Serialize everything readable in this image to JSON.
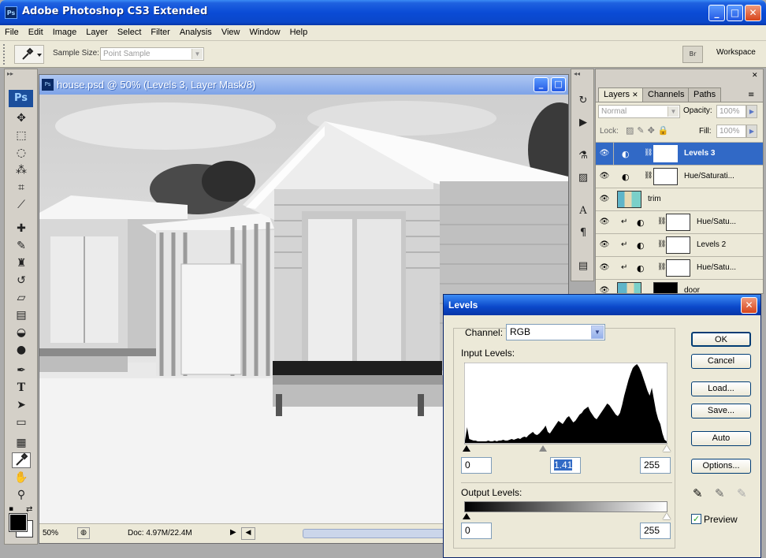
{
  "window": {
    "title": "Adobe Photoshop CS3 Extended",
    "logo": "Ps",
    "minimize": "_",
    "maximize": "□",
    "close": "✕"
  },
  "menu": [
    "File",
    "Edit",
    "Image",
    "Layer",
    "Select",
    "Filter",
    "Analysis",
    "View",
    "Window",
    "Help"
  ],
  "options": {
    "sample_size_label": "Sample Size:",
    "sample_size_value": "Point Sample",
    "workspace_label": "Workspace",
    "workspace_badge": "Br"
  },
  "toolbox": {
    "logo": "Ps",
    "tools": [
      "move-icon",
      "marquee-icon",
      "lasso-icon",
      "magic-wand-icon",
      "crop-icon",
      "slice-icon",
      "healing-icon",
      "brush-icon",
      "stamp-icon",
      "history-brush-icon",
      "eraser-icon",
      "gradient-icon",
      "blur-icon",
      "dodge-icon",
      "pen-icon",
      "type-icon",
      "path-select-icon",
      "shape-icon",
      "notes-icon",
      "eyedropper-icon",
      "hand-icon",
      "zoom-icon"
    ],
    "selected_tool": "eyedropper-icon",
    "type_glyph": "T"
  },
  "document": {
    "title": "house.psd @ 50% (Levels 3, Layer Mask/8)",
    "icon_text": "Ps",
    "zoom": "50%",
    "doc_info": "Doc: 4.97M/22.4M"
  },
  "layers_panel": {
    "tabs": [
      "Layers",
      "Channels",
      "Paths"
    ],
    "blend_mode": "Normal",
    "opacity_label": "Opacity:",
    "opacity_value": "100%",
    "lock_label": "Lock:",
    "fill_label": "Fill:",
    "fill_value": "100%",
    "layers": [
      {
        "name": "Levels 3",
        "type": "adjustment",
        "selected": true,
        "clipped": false
      },
      {
        "name": "Hue/Saturati...",
        "type": "adjustment",
        "selected": false,
        "clipped": false
      },
      {
        "name": "trim",
        "type": "pixel",
        "selected": false,
        "clipped": false
      },
      {
        "name": "Hue/Satu...",
        "type": "adjustment",
        "selected": false,
        "clipped": true
      },
      {
        "name": "Levels 2",
        "type": "adjustment",
        "selected": false,
        "clipped": true
      },
      {
        "name": "Hue/Satu...",
        "type": "adjustment",
        "selected": false,
        "clipped": true
      },
      {
        "name": "door",
        "type": "pixel",
        "selected": false,
        "clipped": false
      }
    ]
  },
  "levels_dialog": {
    "title": "Levels",
    "channel_label": "Channel:",
    "channel_value": "RGB",
    "input_levels_label": "Input Levels:",
    "input_black": "0",
    "input_gamma": "1.41",
    "input_white": "255",
    "output_levels_label": "Output Levels:",
    "output_black": "0",
    "output_white": "255",
    "buttons": {
      "ok": "OK",
      "cancel": "Cancel",
      "load": "Load...",
      "save": "Save...",
      "auto": "Auto",
      "options": "Options..."
    },
    "preview_label": "Preview",
    "preview_checked": true,
    "gamma_slider_position": 0.38,
    "histogram": [
      3,
      20,
      5,
      4,
      3,
      3,
      2,
      2,
      2,
      2,
      2,
      3,
      2,
      2,
      3,
      2,
      3,
      3,
      4,
      3,
      3,
      4,
      5,
      4,
      5,
      6,
      5,
      7,
      8,
      7,
      10,
      12,
      14,
      11,
      10,
      12,
      15,
      18,
      22,
      14,
      12,
      16,
      20,
      24,
      28,
      26,
      24,
      28,
      32,
      34,
      30,
      26,
      28,
      32,
      36,
      38,
      42,
      44,
      46,
      40,
      36,
      32,
      30,
      34,
      38,
      42,
      46,
      50,
      48,
      44,
      40,
      36,
      34,
      38,
      48,
      60,
      70,
      80,
      88,
      95,
      98,
      100,
      96,
      90,
      82,
      74,
      66,
      60,
      70,
      55,
      40,
      30,
      24,
      12,
      4,
      2
    ]
  }
}
